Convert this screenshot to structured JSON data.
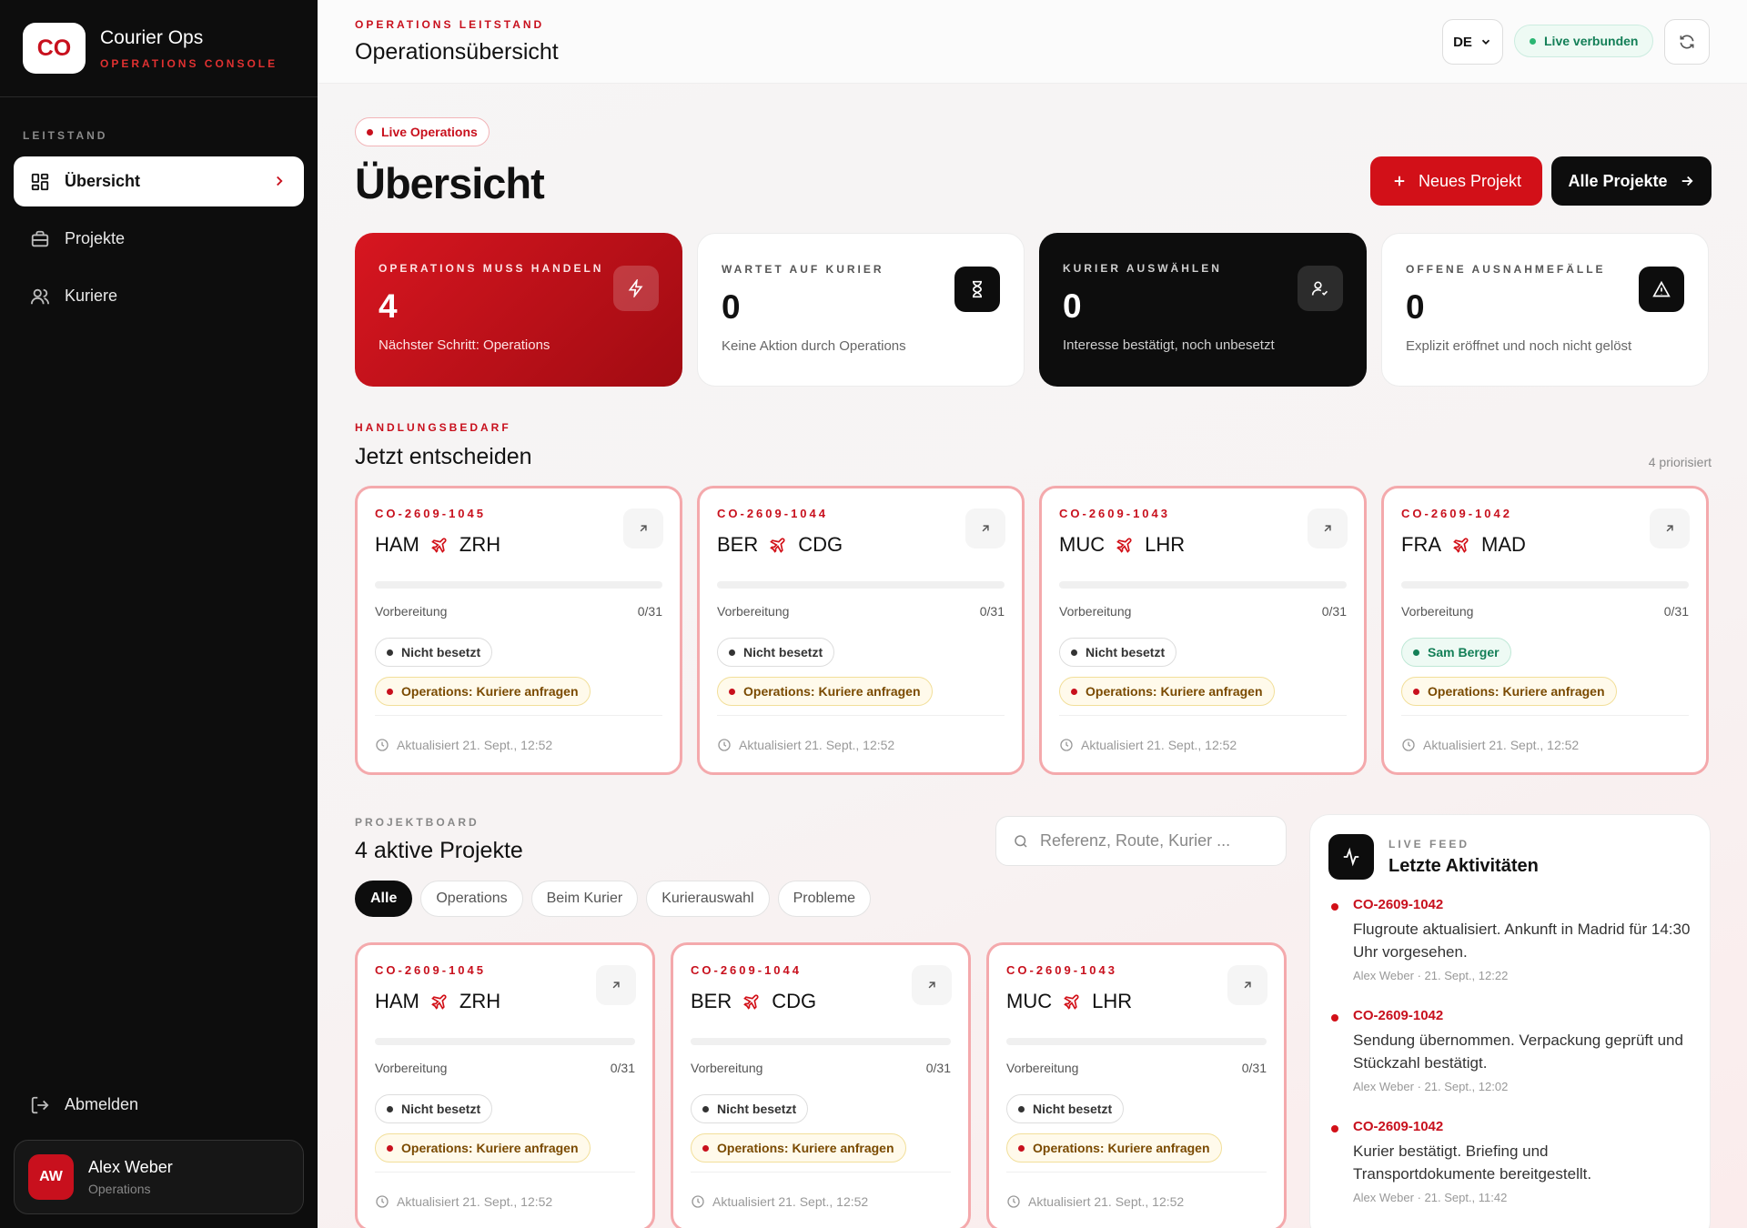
{
  "sidebar": {
    "logo": "CO",
    "brand_name": "Courier Ops",
    "brand_sub": "OPERATIONS CONSOLE",
    "section": "LEITSTAND",
    "items": [
      {
        "label": "Übersicht",
        "icon": "dashboard-icon",
        "active": true
      },
      {
        "label": "Projekte",
        "icon": "briefcase-icon"
      },
      {
        "label": "Kuriere",
        "icon": "users-icon"
      }
    ],
    "logout": "Abmelden",
    "user": {
      "initials": "AW",
      "name": "Alex Weber",
      "role": "Operations"
    }
  },
  "topbar": {
    "kicker": "OPERATIONS LEITSTAND",
    "title": "Operationsübersicht",
    "lang": "DE",
    "live": "Live verbunden"
  },
  "header": {
    "pill": "Live Operations",
    "title": "Übersicht",
    "new_project": "Neues Projekt",
    "all_projects": "Alle Projekte"
  },
  "stats": [
    {
      "label": "OPERATIONS MUSS HANDELN",
      "value": "4",
      "sub": "Nächster Schritt: Operations",
      "icon": "bolt-icon"
    },
    {
      "label": "WARTET AUF KURIER",
      "value": "0",
      "sub": "Keine Aktion durch Operations",
      "icon": "hourglass-icon"
    },
    {
      "label": "KURIER AUSWÄHLEN",
      "value": "0",
      "sub": "Interesse bestätigt, noch unbesetzt",
      "icon": "user-check-icon"
    },
    {
      "label": "OFFENE AUSNAHMEFÄLLE",
      "value": "0",
      "sub": "Explizit eröffnet und noch nicht gelöst",
      "icon": "alert-icon"
    }
  ],
  "decide": {
    "kicker": "HANDLUNGSBEDARF",
    "title": "Jetzt entscheiden",
    "count": "4 priorisiert",
    "cards": [
      {
        "ref": "CO-2609-1045",
        "from": "HAM",
        "to": "ZRH",
        "stage": "Vorbereitung",
        "progress": "0/31",
        "assignee": "Nicht besetzt",
        "assigned": false,
        "action": "Operations: Kuriere anfragen",
        "updated": "Aktualisiert 21. Sept., 12:52"
      },
      {
        "ref": "CO-2609-1044",
        "from": "BER",
        "to": "CDG",
        "stage": "Vorbereitung",
        "progress": "0/31",
        "assignee": "Nicht besetzt",
        "assigned": false,
        "action": "Operations: Kuriere anfragen",
        "updated": "Aktualisiert 21. Sept., 12:52"
      },
      {
        "ref": "CO-2609-1043",
        "from": "MUC",
        "to": "LHR",
        "stage": "Vorbereitung",
        "progress": "0/31",
        "assignee": "Nicht besetzt",
        "assigned": false,
        "action": "Operations: Kuriere anfragen",
        "updated": "Aktualisiert 21. Sept., 12:52"
      },
      {
        "ref": "CO-2609-1042",
        "from": "FRA",
        "to": "MAD",
        "stage": "Vorbereitung",
        "progress": "0/31",
        "assignee": "Sam Berger",
        "assigned": true,
        "action": "Operations: Kuriere anfragen",
        "updated": "Aktualisiert 21. Sept., 12:52"
      }
    ]
  },
  "board": {
    "kicker": "PROJEKTBOARD",
    "title": "4 aktive Projekte",
    "search_placeholder": "Referenz, Route, Kurier ...",
    "filters": [
      "Alle",
      "Operations",
      "Beim Kurier",
      "Kurierauswahl",
      "Probleme"
    ],
    "active_filter": "Alle",
    "cards": [
      {
        "ref": "CO-2609-1045",
        "from": "HAM",
        "to": "ZRH",
        "stage": "Vorbereitung",
        "progress": "0/31",
        "assignee": "Nicht besetzt",
        "action": "Operations: Kuriere anfragen",
        "updated": "Aktualisiert 21. Sept., 12:52"
      },
      {
        "ref": "CO-2609-1044",
        "from": "BER",
        "to": "CDG",
        "stage": "Vorbereitung",
        "progress": "0/31",
        "assignee": "Nicht besetzt",
        "action": "Operations: Kuriere anfragen",
        "updated": "Aktualisiert 21. Sept., 12:52"
      },
      {
        "ref": "CO-2609-1043",
        "from": "MUC",
        "to": "LHR",
        "stage": "Vorbereitung",
        "progress": "0/31",
        "assignee": "Nicht besetzt",
        "action": "Operations: Kuriere anfragen",
        "updated": "Aktualisiert 21. Sept., 12:52"
      }
    ]
  },
  "feed": {
    "kicker": "LIVE FEED",
    "title": "Letzte Aktivitäten",
    "items": [
      {
        "ref": "CO-2609-1042",
        "text": "Flugroute aktualisiert. Ankunft in Madrid für 14:30 Uhr vorgesehen.",
        "meta": "Alex Weber · 21. Sept., 12:22"
      },
      {
        "ref": "CO-2609-1042",
        "text": "Sendung übernommen. Verpackung geprüft und Stückzahl bestätigt.",
        "meta": "Alex Weber · 21. Sept., 12:02"
      },
      {
        "ref": "CO-2609-1042",
        "text": "Kurier bestätigt. Briefing und Transportdokumente bereitgestellt.",
        "meta": "Alex Weber · 21. Sept., 11:42"
      }
    ]
  },
  "colors": {
    "accent": "#d21018",
    "dark": "#0d0d0d",
    "card_border": "#f4a9ac",
    "success": "#137f57"
  }
}
